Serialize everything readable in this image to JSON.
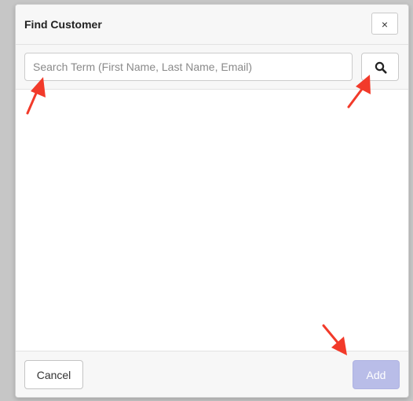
{
  "dialog": {
    "title": "Find Customer",
    "close_label": "×"
  },
  "search": {
    "placeholder": "Search Term (First Name, Last Name, Email)",
    "value": "",
    "button_icon": "search-icon"
  },
  "results": [],
  "footer": {
    "cancel_label": "Cancel",
    "add_label": "Add",
    "add_enabled": false
  },
  "annotations": {
    "arrow_color": "#f23a2a",
    "arrows": [
      "arrow-to-search-input",
      "arrow-to-search-button",
      "arrow-to-add-button"
    ]
  },
  "colors": {
    "add_button_disabled": "#b9bde8",
    "header_background": "#f7f7f7"
  }
}
